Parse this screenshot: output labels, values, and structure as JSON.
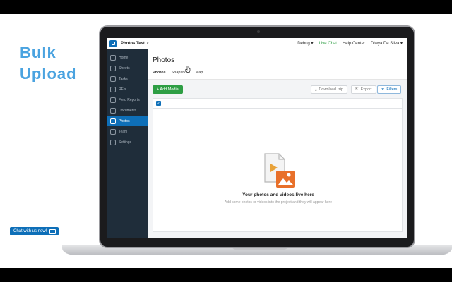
{
  "headline": {
    "line1": "Bulk",
    "line2": "Upload"
  },
  "topbar": {
    "project": "Photos Test",
    "debug": "Debug",
    "live_chat": "Live Chat",
    "help_center": "Help Center",
    "user": "Diwya De Silva"
  },
  "sidebar": {
    "items": [
      {
        "label": "Home",
        "icon": "home-icon"
      },
      {
        "label": "Sheets",
        "icon": "sheets-icon"
      },
      {
        "label": "Tasks",
        "icon": "tasks-icon"
      },
      {
        "label": "RFIs",
        "icon": "rfi-icon"
      },
      {
        "label": "Field Reports",
        "icon": "report-icon"
      },
      {
        "label": "Documents",
        "icon": "documents-icon"
      },
      {
        "label": "Photos",
        "icon": "photos-icon"
      },
      {
        "label": "Team",
        "icon": "team-icon"
      },
      {
        "label": "Settings",
        "icon": "settings-icon"
      }
    ]
  },
  "main": {
    "title": "Photos",
    "tabs": [
      "Photos",
      "Snapshots",
      "Map"
    ],
    "add_media": "+ Add Media",
    "download": "Download .zip",
    "export": "Export",
    "filters": "Filters",
    "empty_title": "Your photos and videos live here",
    "empty_sub": "Add some photos or videos into the project and they will appear here"
  },
  "chat": {
    "label": "Chat with us now!"
  },
  "colors": {
    "accent": "#0e6fb8",
    "green": "#2e9e44",
    "sidebar": "#1f2d3a",
    "headline": "#4aa3e0",
    "illustration": "#e8702a"
  }
}
